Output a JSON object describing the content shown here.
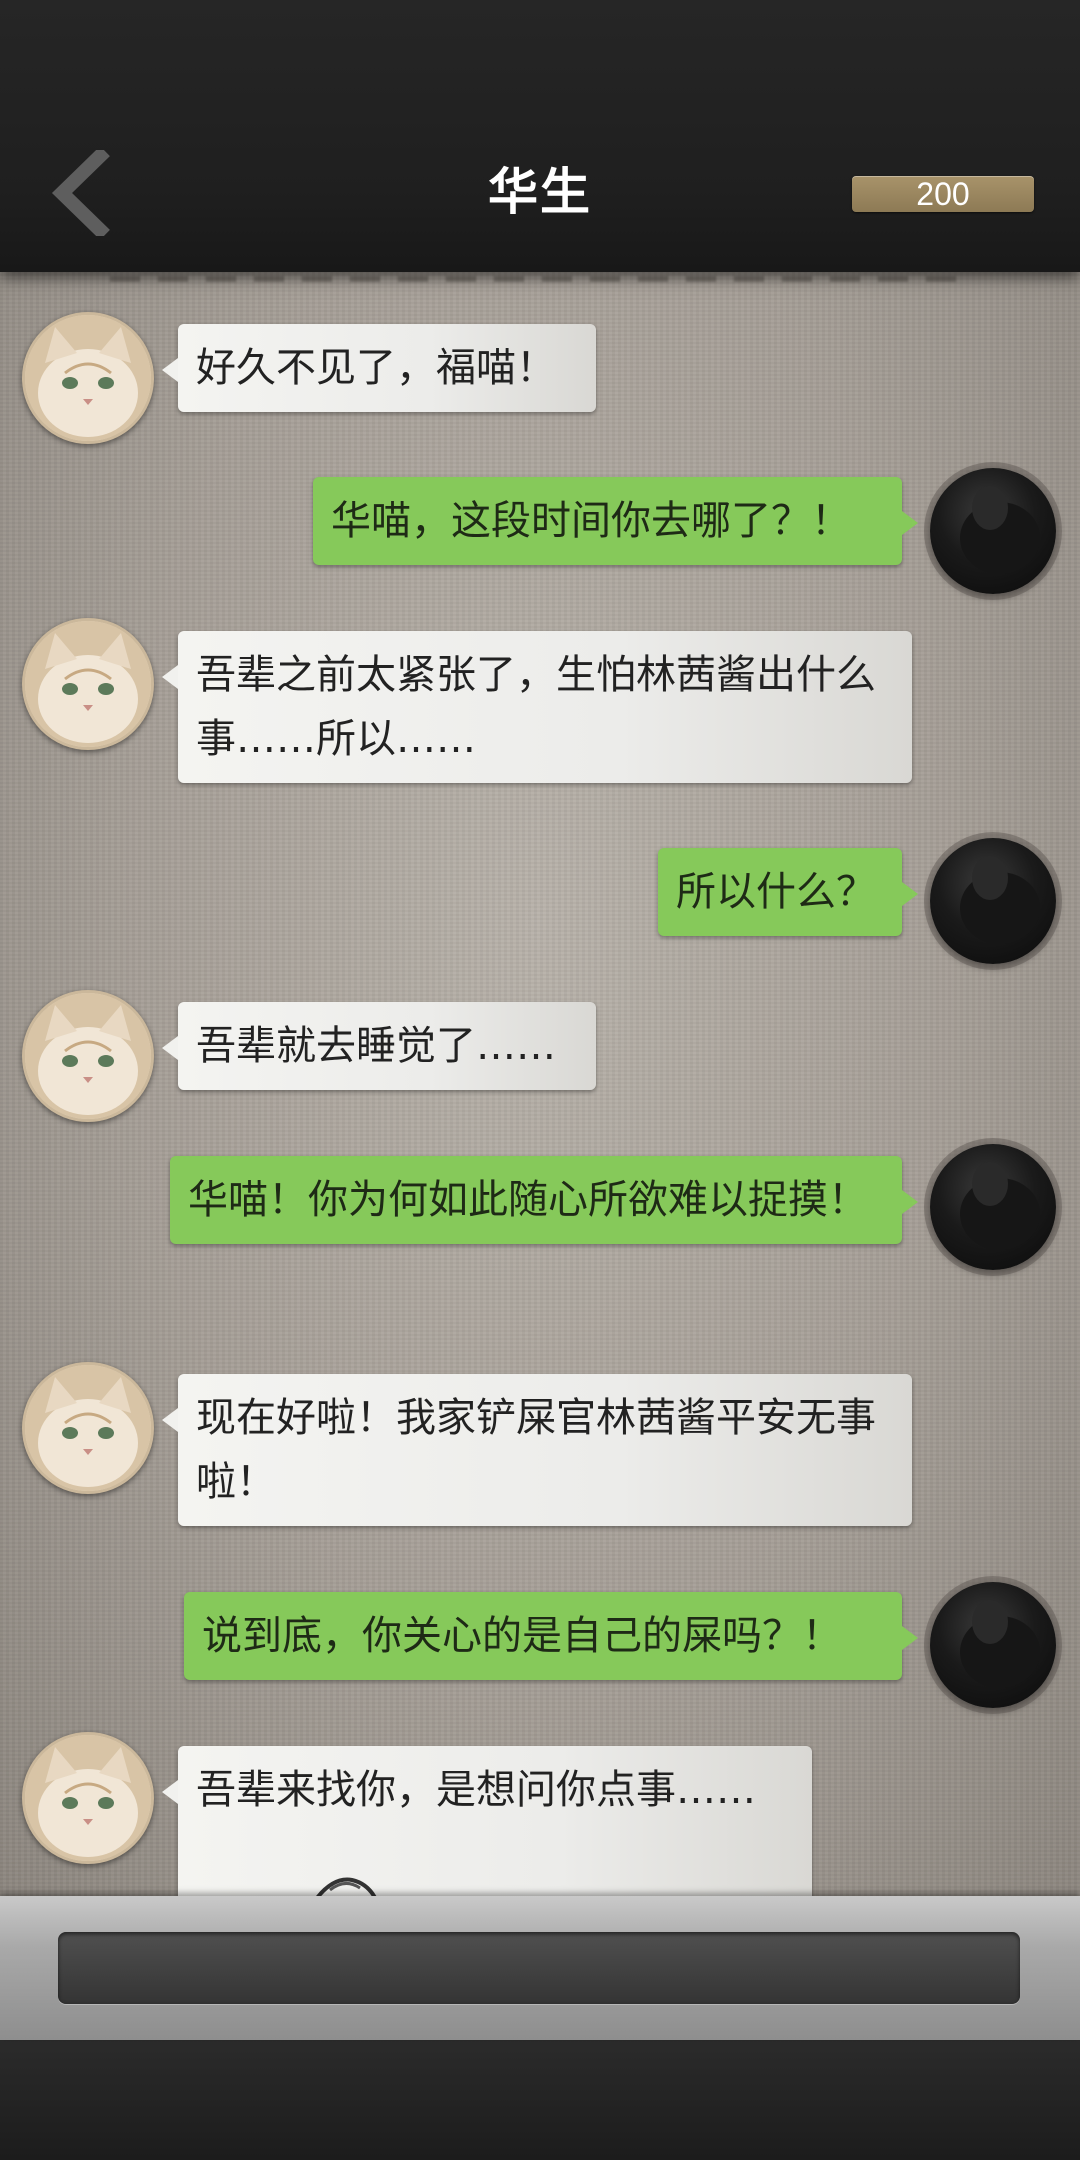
{
  "header": {
    "title": "华生",
    "coins": "200",
    "back_icon": "chevron-left-icon"
  },
  "messages": [
    {
      "side": "left",
      "sender": "cat",
      "text": "好久不见了，福喵！"
    },
    {
      "side": "right",
      "sender": "me",
      "text": "华喵，这段时间你去哪了？！"
    },
    {
      "side": "left",
      "sender": "cat",
      "text": "吾辈之前太紧张了，生怕林茜酱出什么事……所以……"
    },
    {
      "side": "right",
      "sender": "me",
      "text": "所以什么？"
    },
    {
      "side": "left",
      "sender": "cat",
      "text": "吾辈就去睡觉了……"
    },
    {
      "side": "right",
      "sender": "me",
      "text": "华喵！你为何如此随心所欲难以捉摸！"
    },
    {
      "side": "left",
      "sender": "cat",
      "text": "现在好啦！我家铲屎官林茜酱平安无事啦！"
    },
    {
      "side": "right",
      "sender": "me",
      "text": "说到底，你关心的是自己的屎吗？！"
    },
    {
      "side": "left",
      "sender": "cat",
      "text": "吾辈来找你，是想问你点事……"
    }
  ],
  "input": {
    "value": "",
    "placeholder": ""
  },
  "colors": {
    "my_bubble": "#86c95a",
    "their_bubble": "#efefec",
    "coin_badge": "#9c875f",
    "topbar": "#222222"
  }
}
